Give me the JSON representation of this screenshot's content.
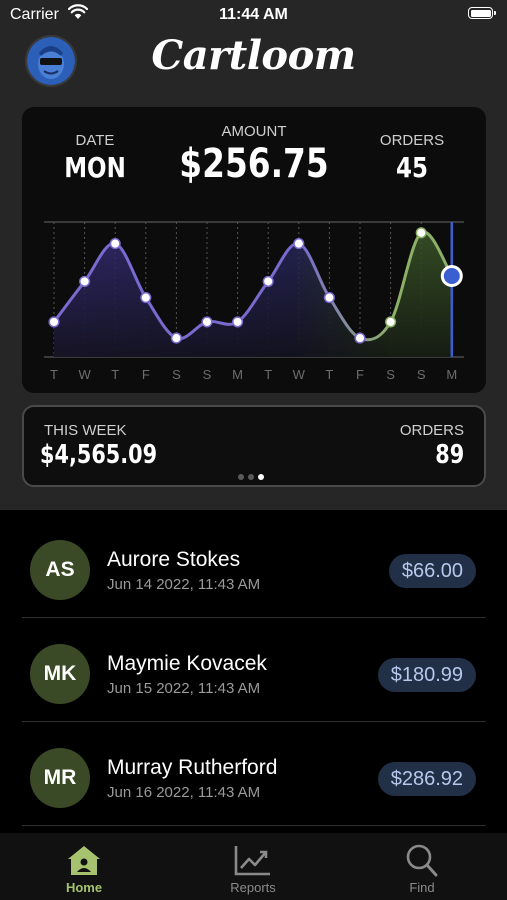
{
  "status_bar": {
    "carrier": "Carrier",
    "time": "11:44 AM"
  },
  "app": {
    "title": "Cartloom"
  },
  "summary": {
    "date_label": "DATE",
    "date_value": "MON",
    "amount_label": "AMOUNT",
    "amount_value": "$256.75",
    "orders_label": "ORDERS",
    "orders_value": "45"
  },
  "chart_data": {
    "type": "area",
    "x": [
      "T",
      "W",
      "T",
      "F",
      "S",
      "S",
      "M",
      "T",
      "W",
      "T",
      "F",
      "S",
      "S",
      "M"
    ],
    "values": [
      0.26,
      0.56,
      0.84,
      0.44,
      0.14,
      0.26,
      0.26,
      0.56,
      0.84,
      0.44,
      0.14,
      0.26,
      0.92,
      0.6
    ],
    "selected_index": 13,
    "colors": {
      "purple": "#7a6ad0",
      "green": "#8cb066",
      "marker": "#3a5fd0"
    }
  },
  "week_card": {
    "this_week_label": "THIS WEEK",
    "this_week_value": "$4,565.09",
    "orders_label": "ORDERS",
    "orders_value": "89",
    "page": 3,
    "page_count": 3
  },
  "orders": [
    {
      "initials": "AS",
      "name": "Aurore Stokes",
      "date": "Jun 14 2022, 11:43 AM",
      "amount": "$66.00"
    },
    {
      "initials": "MK",
      "name": "Maymie Kovacek",
      "date": "Jun 15 2022, 11:43 AM",
      "amount": "$180.99"
    },
    {
      "initials": "MR",
      "name": "Murray Rutherford",
      "date": "Jun 16 2022, 11:43 AM",
      "amount": "$286.92"
    }
  ],
  "tabs": [
    {
      "label": "Home",
      "icon": "home-icon",
      "active": true
    },
    {
      "label": "Reports",
      "icon": "chart-icon",
      "active": false
    },
    {
      "label": "Find",
      "icon": "search-icon",
      "active": false
    }
  ],
  "accent_color": "#a7c26f"
}
